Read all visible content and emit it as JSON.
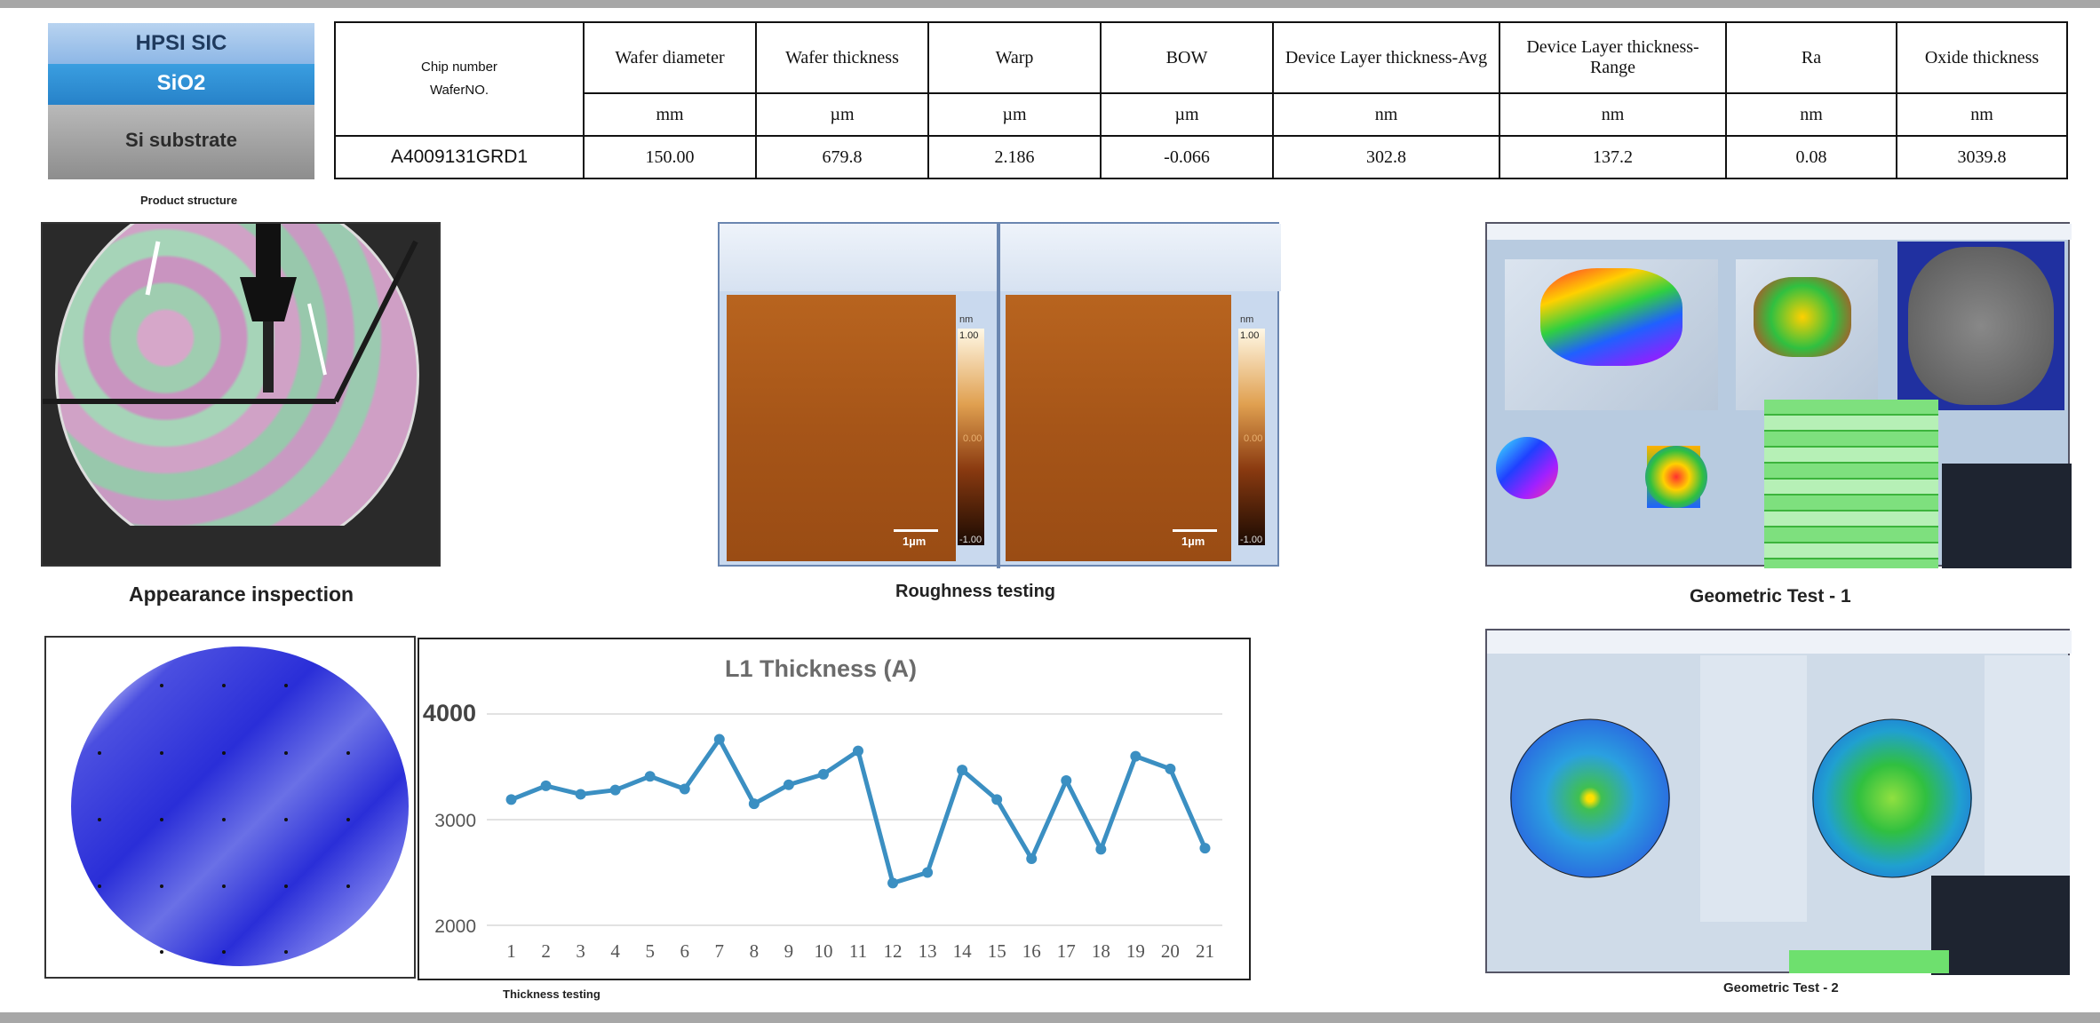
{
  "structure": {
    "layer1": "HPSI SIC",
    "layer2": "SiO2",
    "layer3": "Si substrate",
    "caption": "Product structure"
  },
  "spec_table": {
    "chip_label_1": "Chip number",
    "chip_label_2": "WaferNO.",
    "headers": [
      "Wafer diameter",
      "Wafer thickness",
      "Warp",
      "BOW",
      "Device Layer  thickness-Avg",
      "Device Layer thickness-Range",
      "Ra",
      "Oxide thickness"
    ],
    "units": [
      "mm",
      "µm",
      "µm",
      "µm",
      "nm",
      "nm",
      "nm",
      "nm"
    ],
    "wafer_no": "A4009131GRD1",
    "values": [
      "150.00",
      "679.8",
      "2.186",
      "-0.066",
      "302.8",
      "137.2",
      "0.08",
      "3039.8"
    ]
  },
  "captions": {
    "appearance": "Appearance inspection",
    "roughness": "Roughness testing",
    "geo1": "Geometric Test - 1",
    "thickness": "Thickness testing",
    "geo2": "Geometric Test - 2"
  },
  "afm": {
    "scale_unit": "nm",
    "scale_top": "1.00",
    "scale_mid": "0.00",
    "scale_bottom_left": "-1.00",
    "scale_bottom_right": "-1.00",
    "bar_label": "1µm"
  },
  "chart_data": {
    "type": "line",
    "title": "L1 Thickness (A)",
    "categories": [
      "1",
      "2",
      "3",
      "4",
      "5",
      "6",
      "7",
      "8",
      "9",
      "10",
      "11",
      "12",
      "13",
      "14",
      "15",
      "16",
      "17",
      "18",
      "19",
      "20",
      "21"
    ],
    "values": [
      3190,
      3320,
      3240,
      3280,
      3410,
      3290,
      3760,
      3150,
      3330,
      3430,
      3650,
      2400,
      2500,
      3470,
      3190,
      2630,
      3370,
      2720,
      3600,
      3480,
      2730
    ],
    "ylim": [
      2000,
      4000
    ],
    "yticks": [
      "4000",
      "3000",
      "2000"
    ],
    "color": "#3b8fc2"
  }
}
